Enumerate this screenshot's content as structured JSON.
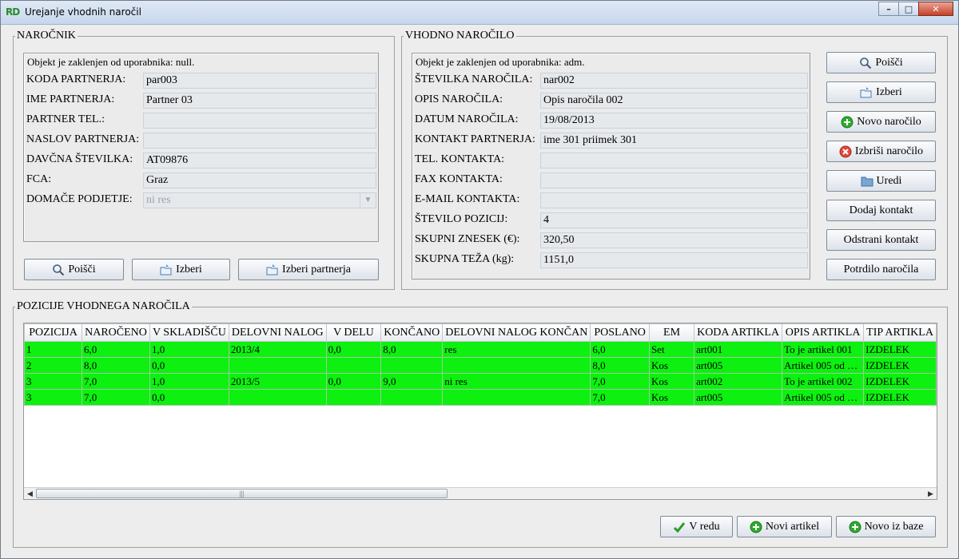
{
  "window": {
    "title": "Urejanje vhodnih naročil",
    "logo": "RD",
    "minimize": "–",
    "maximize": "□",
    "close": "✕"
  },
  "narocnik": {
    "legend": "NAROČNIK",
    "lock_msg": "Objekt je zaklenjen od uporabnika: null.",
    "fields": [
      {
        "label": "KODA PARTNERJA:",
        "value": "par003"
      },
      {
        "label": "IME PARTNERJA:",
        "value": "Partner 03"
      },
      {
        "label": "PARTNER TEL.:",
        "value": ""
      },
      {
        "label": "NASLOV PARTNERJA:",
        "value": ""
      },
      {
        "label": "DAVČNA ŠTEVILKA:",
        "value": "AT09876"
      },
      {
        "label": "FCA:",
        "value": "Graz"
      }
    ],
    "domace": {
      "label": "DOMAČE PODJETJE:",
      "value": "ni res"
    },
    "buttons": {
      "poisci": "Poišči",
      "izberi": "Izberi",
      "izberi_partnerja": "Izberi partnerja"
    }
  },
  "vhodno": {
    "legend": "VHODNO NAROČILO",
    "lock_msg": "Objekt je zaklenjen od uporabnika: adm.",
    "fields": [
      {
        "label": "ŠTEVILKA NAROČILA:",
        "value": "nar002"
      },
      {
        "label": "OPIS NAROČILA:",
        "value": "Opis naročila 002"
      },
      {
        "label": "DATUM NAROČILA:",
        "value": "19/08/2013"
      },
      {
        "label": "KONTAKT PARTNERJA:",
        "value": "ime 301 priimek 301"
      },
      {
        "label": "TEL. KONTAKTA:",
        "value": ""
      },
      {
        "label": "FAX KONTAKTA:",
        "value": ""
      },
      {
        "label": "E-MAIL KONTAKTA:",
        "value": ""
      },
      {
        "label": "ŠTEVILO POZICIJ:",
        "value": "4"
      },
      {
        "label": "SKUPNI ZNESEK (€):",
        "value": "320,50"
      },
      {
        "label": "SKUPNA TEŽA (kg):",
        "value": "1151,0"
      }
    ],
    "buttons": {
      "poisci": "Poišči",
      "izberi": "Izberi",
      "novo": "Novo naročilo",
      "izbrisi": "Izbriši naročilo",
      "uredi": "Uredi",
      "dodaj_kontakt": "Dodaj kontakt",
      "odstrani_kontakt": "Odstrani kontakt",
      "potrdilo": "Potrdilo naročila"
    }
  },
  "pozicije": {
    "legend": "POZICIJE VHODNEGA NAROČILA",
    "columns": [
      "POZICIJA",
      "NAROČENO",
      "V SKLADIŠČU",
      "DELOVNI NALOG",
      "V DELU",
      "KONČANO",
      "DELOVNI NALOG KONČAN",
      "POSLANO",
      "EM",
      "KODA ARTIKLA",
      "OPIS ARTIKLA",
      "TIP ARTIKLA"
    ],
    "rows": [
      [
        "1",
        "6,0",
        "1,0",
        "2013/4",
        "0,0",
        "8,0",
        "res",
        "6,0",
        "Set",
        "art001",
        "To je artikel 001",
        "IZDELEK"
      ],
      [
        "2",
        "8,0",
        "0,0",
        "",
        "",
        "",
        "",
        "8,0",
        "Kos",
        "art005",
        "Artikel 005 od …",
        "IZDELEK"
      ],
      [
        "3",
        "7,0",
        "1,0",
        "2013/5",
        "0,0",
        "9,0",
        "ni res",
        "7,0",
        "Kos",
        "art002",
        "To je artikel 002",
        "IZDELEK"
      ],
      [
        "3",
        "7,0",
        "0,0",
        "",
        "",
        "",
        "",
        "7,0",
        "Kos",
        "art005",
        "Artikel 005 od …",
        "IZDELEK"
      ]
    ],
    "scroll": {
      "left": "◀",
      "right": "▶",
      "grip": "|||"
    }
  },
  "footer": {
    "v_redu": "V redu",
    "novi_artikel": "Novi artikel",
    "novo_iz_baze": "Novo iz baze"
  },
  "colors": {
    "row_bg": "#0df010",
    "window_bg": "#ededed"
  }
}
